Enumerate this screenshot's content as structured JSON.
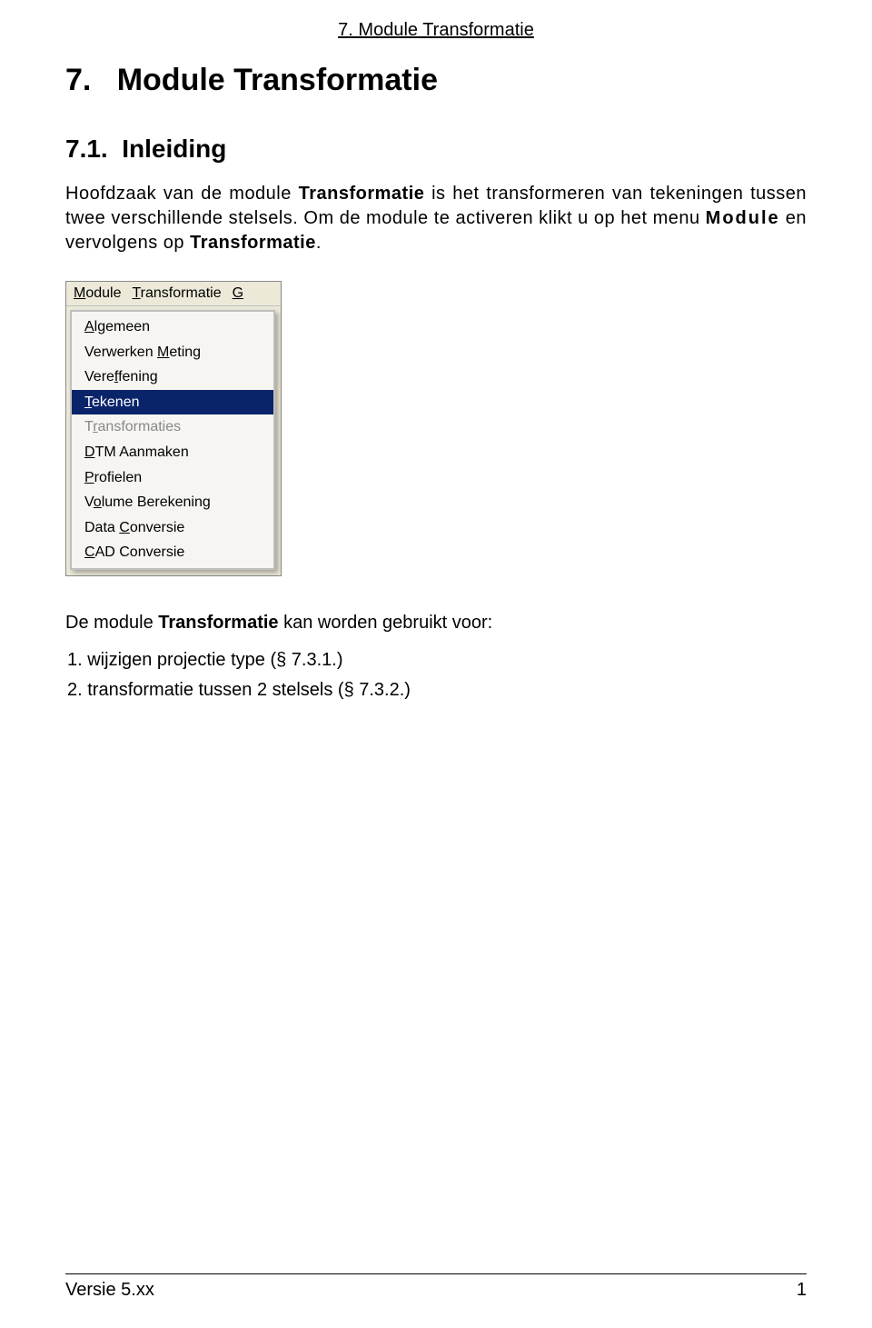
{
  "header": {
    "running": "7. Module Transformatie"
  },
  "title": {
    "number": "7.",
    "text": "Module Transformatie"
  },
  "section": {
    "number": "7.1.",
    "title": "Inleiding"
  },
  "paragraph": {
    "p1a": "Hoofdzaak van de module ",
    "p1b_bold": "Transformatie",
    "p1c": " is het transformeren van tekeningen tussen twee verschillende stelsels. Om de module te activeren klikt u op het menu ",
    "p1d_bold_wide": "Module",
    "p1e": " en vervolgens op ",
    "p1f_bold": "Transformatie",
    "p1g": "."
  },
  "menubar": {
    "items": [
      {
        "pre": "",
        "u": "M",
        "post": "odule"
      },
      {
        "pre": "",
        "u": "T",
        "post": "ransformatie"
      },
      {
        "pre": "",
        "u": "G",
        "post": ""
      }
    ]
  },
  "dropdown": {
    "items": [
      {
        "pre": "",
        "u": "A",
        "post": "lgemeen",
        "state": "normal"
      },
      {
        "pre": "Verwerken ",
        "u": "M",
        "post": "eting",
        "state": "normal"
      },
      {
        "pre": "Vere",
        "u": "f",
        "post": "fening",
        "state": "normal"
      },
      {
        "pre": "",
        "u": "T",
        "post": "ekenen",
        "state": "selected"
      },
      {
        "pre": "T",
        "u": "r",
        "post": "ansformaties",
        "state": "disabled"
      },
      {
        "pre": "",
        "u": "D",
        "post": "TM Aanmaken",
        "state": "normal"
      },
      {
        "pre": "",
        "u": "P",
        "post": "rofielen",
        "state": "normal"
      },
      {
        "pre": "V",
        "u": "o",
        "post": "lume Berekening",
        "state": "normal"
      },
      {
        "pre": "Data ",
        "u": "C",
        "post": "onversie",
        "state": "normal"
      },
      {
        "pre": "",
        "u": "C",
        "post": "AD Conversie",
        "state": "normal"
      }
    ]
  },
  "after": {
    "line_a": "De module ",
    "line_bold": "Transformatie",
    "line_c": " kan worden gebruikt voor:"
  },
  "list": {
    "items": [
      "1.  wijzigen projectie type (§ 7.3.1.)",
      "2.  transformatie tussen 2 stelsels (§ 7.3.2.)"
    ]
  },
  "footer": {
    "left": "Versie 5.xx",
    "right": "1"
  }
}
